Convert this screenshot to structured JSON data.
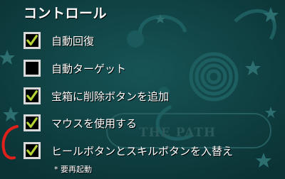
{
  "header": {
    "title": "コントロール"
  },
  "options": [
    {
      "label": "自動回復",
      "checked": true
    },
    {
      "label": "自動ターゲット",
      "checked": false
    },
    {
      "label": "宝箱に削除ボタンを追加",
      "checked": true
    },
    {
      "label": "マウスを使用する",
      "checked": true
    },
    {
      "label": "ヒールボタンとスキルボタンを入替え",
      "checked": true
    }
  ],
  "footer": {
    "note": "* 要再起動"
  },
  "background": {
    "watermark": "THE PATH"
  },
  "colors": {
    "background": "#0e3d3f",
    "check": "#b4d334",
    "annotation": "#e0201b"
  },
  "icons": {
    "checkbox_checked": "check-icon"
  }
}
